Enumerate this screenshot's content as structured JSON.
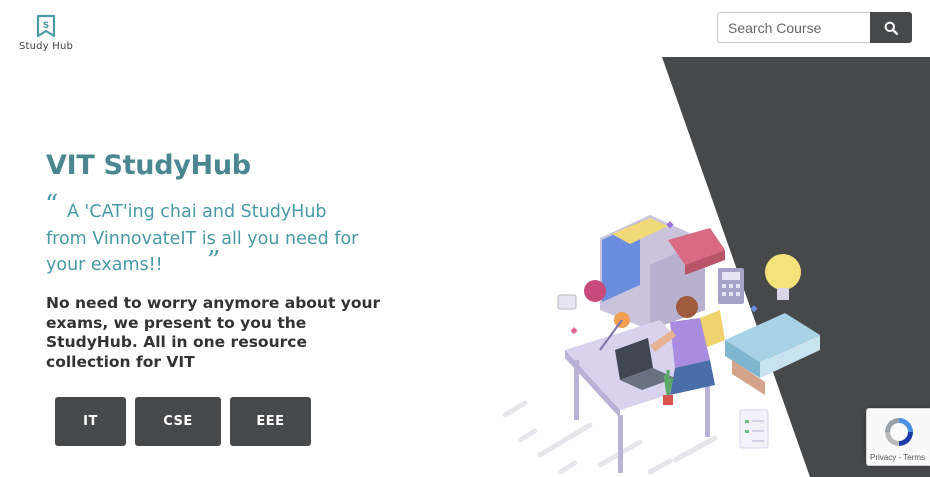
{
  "logo": {
    "letter": "S",
    "text": "Study Hub"
  },
  "search": {
    "placeholder": "Search Course",
    "icon": "search-icon"
  },
  "hero": {
    "title": "VIT StudyHub",
    "quote_open": "“",
    "quote": "A 'CAT'ing chai and StudyHub from VinnovateIT is all you need for your exams!!",
    "quote_close": "”",
    "description": "No need to worry anymore about your exams, we present to you the StudyHub. All in one resource collection for VIT"
  },
  "courses": [
    {
      "label": "IT"
    },
    {
      "label": "CSE"
    },
    {
      "label": "EEE"
    }
  ],
  "recaptcha": {
    "privacy": "Privacy",
    "sep": " - ",
    "terms": "Terms"
  },
  "colors": {
    "accent": "#4a8791",
    "quote": "#4a9aa6",
    "dark": "#474849",
    "page_bg": "#ffffff"
  }
}
